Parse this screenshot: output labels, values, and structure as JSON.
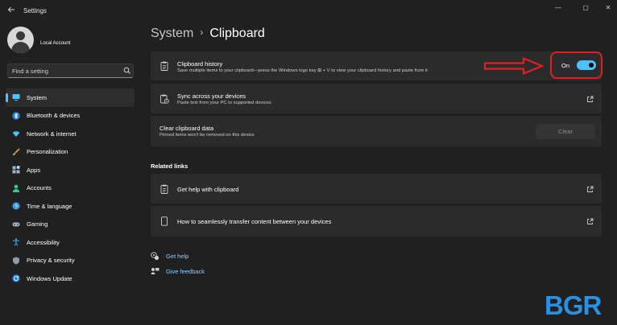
{
  "window": {
    "title": "Settings",
    "controls": {
      "minimize": "—",
      "maximize": "▢",
      "close": "✕"
    }
  },
  "profile": {
    "name": "Local Account"
  },
  "search": {
    "placeholder": "Find a setting"
  },
  "sidebar": {
    "items": [
      {
        "label": "System",
        "icon": "monitor-icon",
        "active": true
      },
      {
        "label": "Bluetooth & devices",
        "icon": "bluetooth-icon",
        "active": false
      },
      {
        "label": "Network & internet",
        "icon": "wifi-icon",
        "active": false
      },
      {
        "label": "Personalization",
        "icon": "brush-icon",
        "active": false
      },
      {
        "label": "Apps",
        "icon": "apps-icon",
        "active": false
      },
      {
        "label": "Accounts",
        "icon": "person-icon",
        "active": false
      },
      {
        "label": "Time & language",
        "icon": "globe-clock-icon",
        "active": false
      },
      {
        "label": "Gaming",
        "icon": "gamepad-icon",
        "active": false
      },
      {
        "label": "Accessibility",
        "icon": "accessibility-icon",
        "active": false
      },
      {
        "label": "Privacy & security",
        "icon": "shield-icon",
        "active": false
      },
      {
        "label": "Windows Update",
        "icon": "update-icon",
        "active": false
      }
    ]
  },
  "breadcrumb": {
    "parent": "System",
    "separator": "›",
    "current": "Clipboard"
  },
  "cards": {
    "history": {
      "title": "Clipboard history",
      "description": "Save multiple items to your clipboard—press the Windows logo key ⊞ + V to view your clipboard history and paste from it",
      "toggle_label": "On",
      "toggle_on": true
    },
    "sync": {
      "title": "Sync across your devices",
      "description": "Paste text from your PC to supported devices"
    },
    "clear": {
      "title": "Clear clipboard data",
      "description": "Pinned items won't be removed on this device",
      "button_label": "Clear"
    }
  },
  "related": {
    "heading": "Related links",
    "links": [
      {
        "label": "Get help with clipboard"
      },
      {
        "label": "How to seamlessly transfer content between your devices"
      }
    ]
  },
  "help": {
    "get_help": "Get help",
    "feedback": "Give feedback"
  },
  "watermark": {
    "text": "BGR"
  },
  "colors": {
    "accent": "#4cc2ff",
    "background": "#202020",
    "card": "#2b2b2b",
    "annotation": "#e02020",
    "watermark": "#2a90e0"
  }
}
